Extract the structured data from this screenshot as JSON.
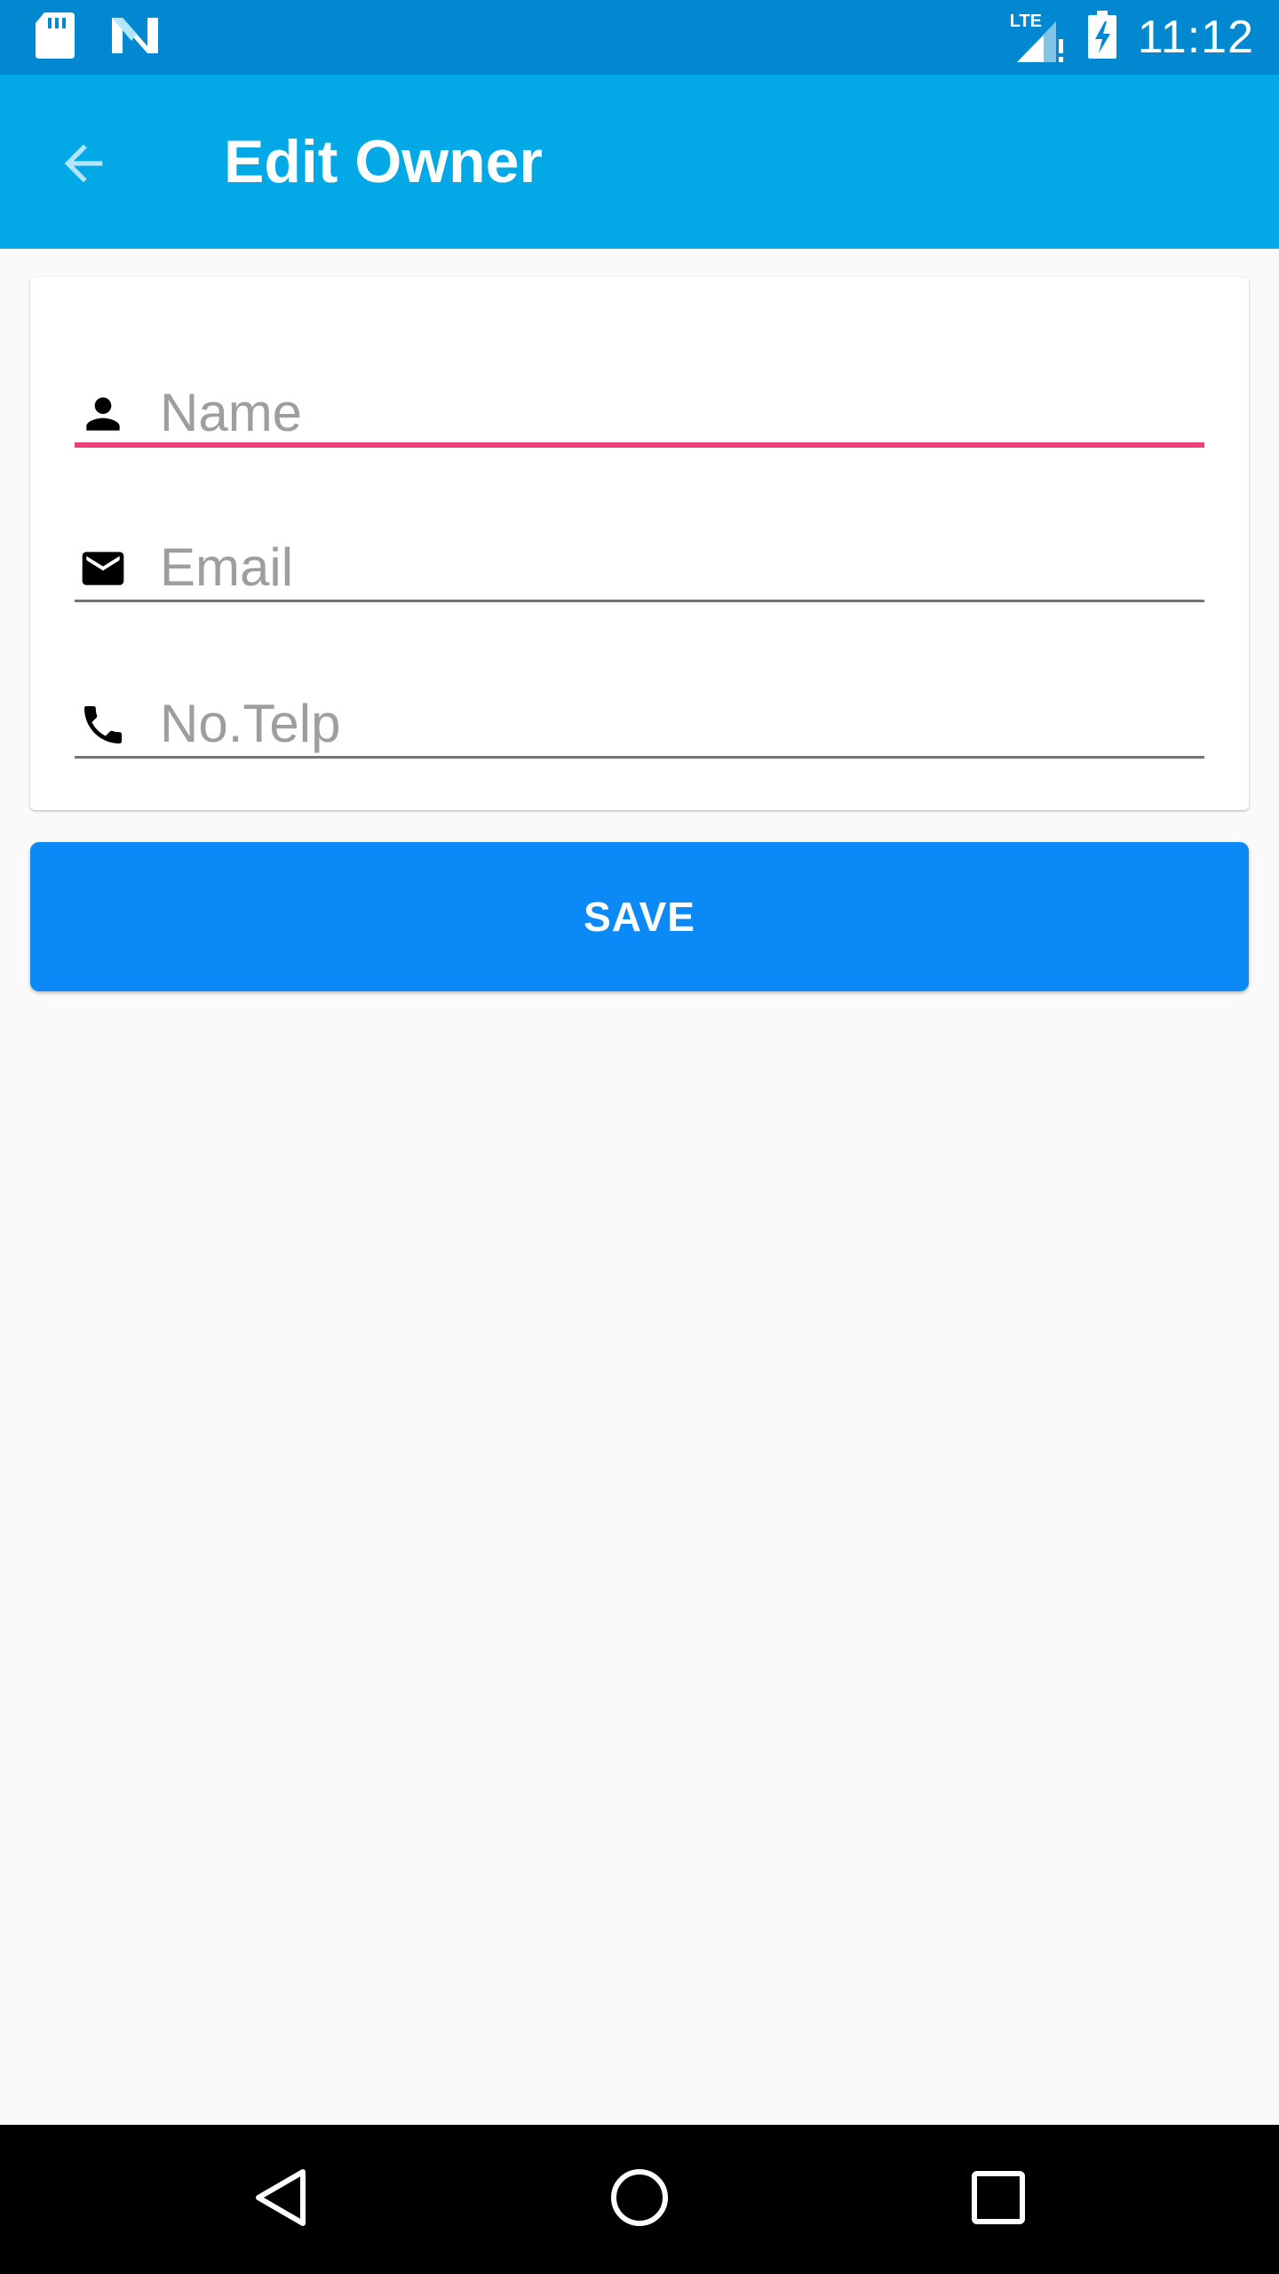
{
  "status_bar": {
    "time": "11:12",
    "network_label": "LTE",
    "icons": [
      "sd-card-icon",
      "n-notification-icon",
      "lte-signal-icon",
      "battery-charging-icon"
    ]
  },
  "app_bar": {
    "title": "Edit Owner",
    "back_icon": "arrow-back-icon",
    "background_color": "#03a9e6"
  },
  "form": {
    "fields": [
      {
        "icon": "person-icon",
        "placeholder": "Name",
        "value": "",
        "focused": true
      },
      {
        "icon": "email-icon",
        "placeholder": "Email",
        "value": "",
        "focused": false
      },
      {
        "icon": "phone-icon",
        "placeholder": "No.Telp",
        "value": "",
        "focused": false
      }
    ],
    "focus_color": "#ec407a"
  },
  "save_button": {
    "label": "SAVE",
    "color": "#0a89f7"
  },
  "nav_bar": {
    "icons": [
      "back-triangle-icon",
      "home-circle-icon",
      "recents-square-icon"
    ]
  }
}
